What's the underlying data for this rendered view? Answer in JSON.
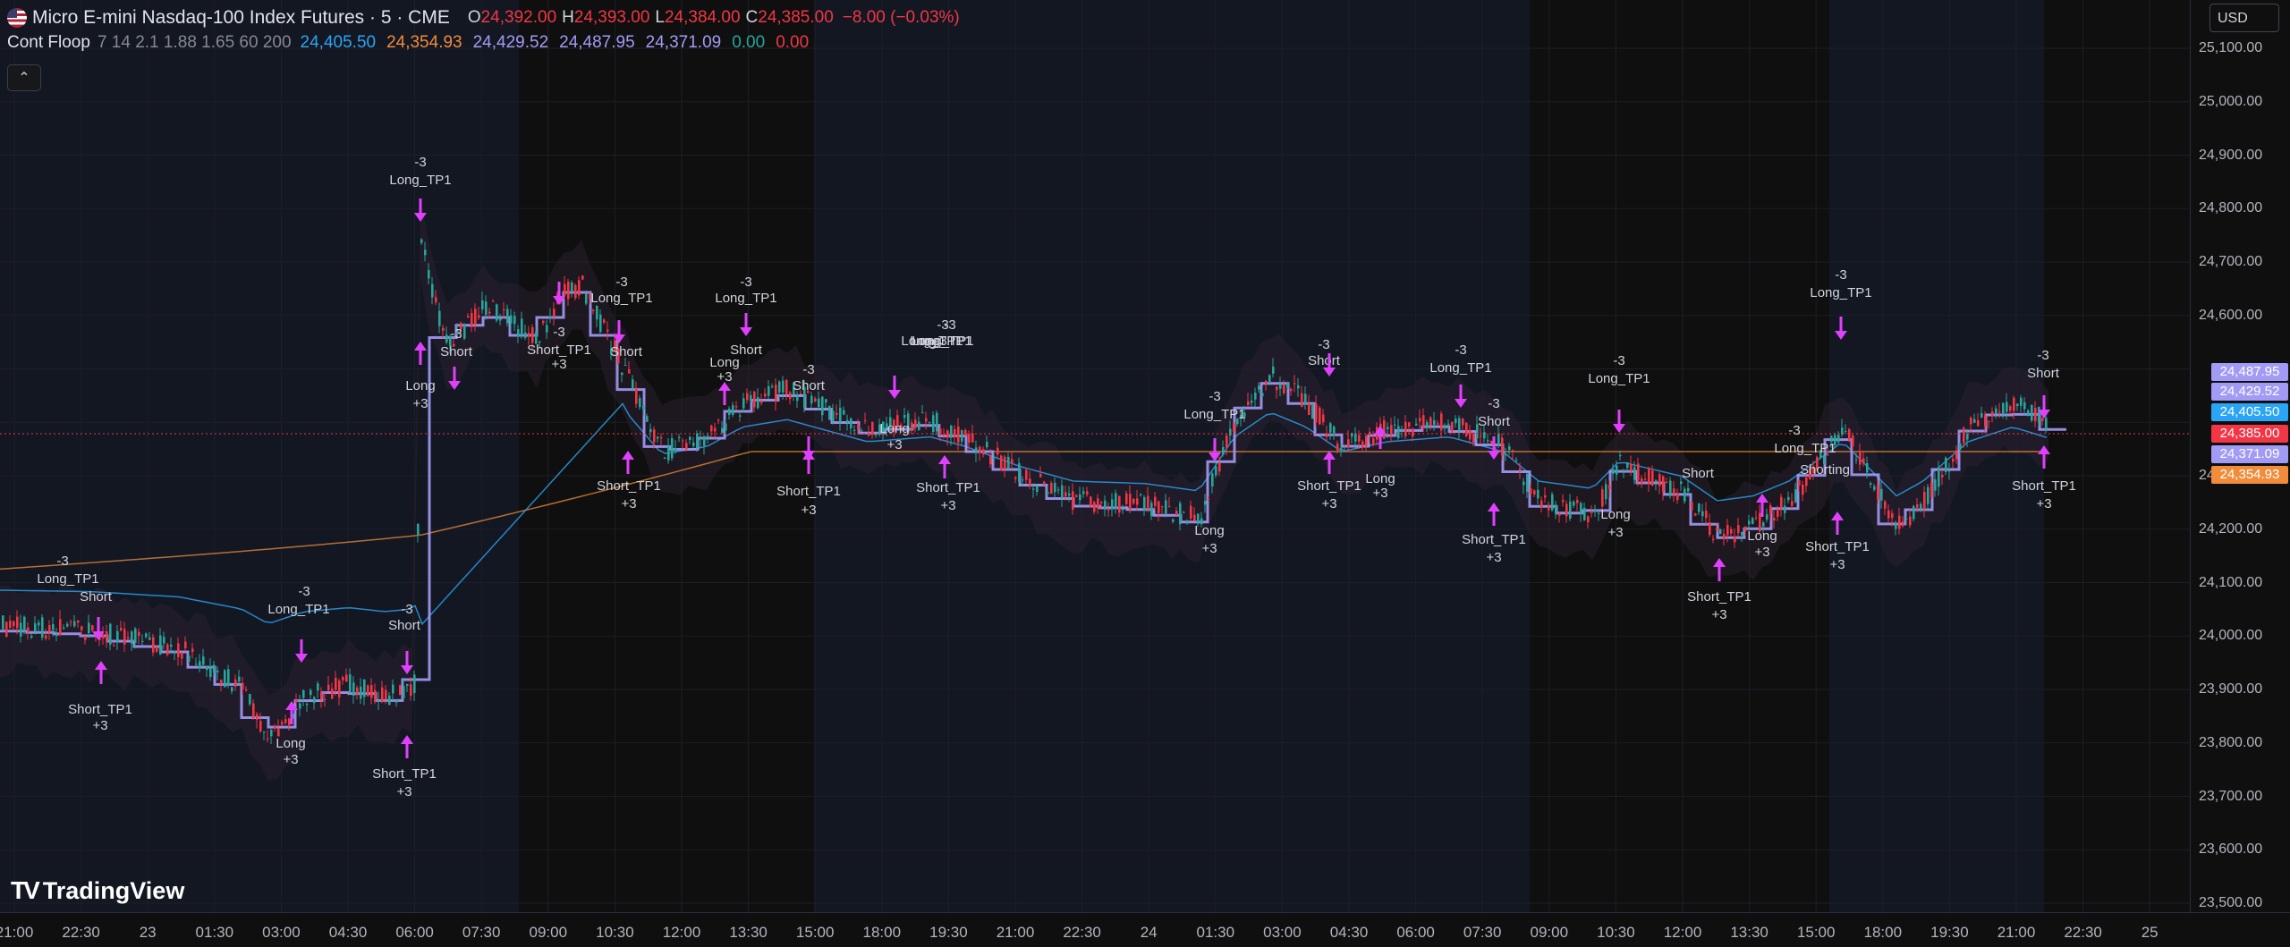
{
  "symbol": {
    "name": "Micro E-mini Nasdaq-100 Index Futures · 5 · CME",
    "open_label": "O",
    "open": "24,392.00",
    "high_label": "H",
    "high": "24,393.00",
    "low_label": "L",
    "low": "24,384.00",
    "close_label": "C",
    "close": "24,385.00",
    "change": "−8.00 (−0.03%)"
  },
  "indicator": {
    "name": "Cont Floop",
    "params": "7 14 2.1 1.88 1.65 60 200",
    "values": [
      {
        "text": "24,405.50",
        "color": "#2aa5f5"
      },
      {
        "text": "24,354.93",
        "color": "#f08c3a"
      },
      {
        "text": "24,429.52",
        "color": "#a29bf5"
      },
      {
        "text": "24,487.95",
        "color": "#a29bf5"
      },
      {
        "text": "24,371.09",
        "color": "#a29bf5"
      },
      {
        "text": "0.00",
        "color": "#26a69a"
      },
      {
        "text": "0.00",
        "color": "#f23645"
      }
    ]
  },
  "collapse_icon": "chevron-up-icon",
  "currency": "USD",
  "price_axis": {
    "labels": [
      "25,100.00",
      "25,000.00",
      "24,900.00",
      "24,800.00",
      "24,700.00",
      "24,600.00",
      "24,300.00",
      "24,200.00",
      "24,100.00",
      "24,000.00",
      "23,900.00",
      "23,800.00",
      "23,700.00",
      "23,600.00",
      "23,500.00"
    ],
    "tags": [
      {
        "text": "24,487.95",
        "bg": "#a29bf5"
      },
      {
        "text": "24,429.52",
        "bg": "#a29bf5"
      },
      {
        "text": "24,405.50",
        "bg": "#2aa5f5"
      },
      {
        "text": "24,385.00",
        "bg": "#f23645"
      },
      {
        "text": "24,371.09",
        "bg": "#a29bf5"
      },
      {
        "text": "24,354.93",
        "bg": "#f08c3a"
      }
    ]
  },
  "time_axis": {
    "labels": [
      "21:00",
      "22:30",
      "23",
      "01:30",
      "03:00",
      "04:30",
      "06:00",
      "07:30",
      "09:00",
      "10:30",
      "12:00",
      "13:30",
      "15:00",
      "18:00",
      "19:30",
      "21:00",
      "22:30",
      "24",
      "01:30",
      "03:00",
      "04:30",
      "06:00",
      "07:30",
      "09:00",
      "10:30",
      "12:00",
      "13:30",
      "15:00",
      "18:00",
      "19:30",
      "21:00",
      "22:30",
      "25"
    ]
  },
  "signals": {
    "minus3": "-3",
    "plus3": "+3",
    "long": "Long",
    "short": "Short",
    "long_tp1": "Long_TP1",
    "short_tp1": "Short_TP1",
    "shorting": "Shorting"
  },
  "brand": {
    "name": "TradingView",
    "icon": "tradingview-logo-icon"
  },
  "colors": {
    "up": "#26a69a",
    "down": "#f23645",
    "cyan": "#2aa5f5",
    "orange": "#f08c3a",
    "purple": "#a29bf5",
    "magenta": "#e040fb",
    "background": "#0f0f0f",
    "session": "#131722"
  }
}
